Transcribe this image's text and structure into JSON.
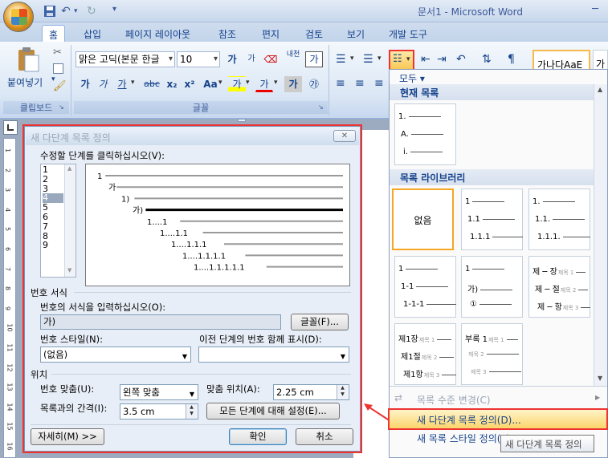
{
  "window": {
    "title": "문서1 - Microsoft Word"
  },
  "tabs": [
    {
      "label": "홈"
    },
    {
      "label": "삽입"
    },
    {
      "label": "페이지 레이아웃"
    },
    {
      "label": "참조"
    },
    {
      "label": "편지"
    },
    {
      "label": "검토"
    },
    {
      "label": "보기"
    },
    {
      "label": "개발 도구"
    }
  ],
  "ribbon": {
    "clipboard": {
      "paste": "붙여넣기",
      "label": "클립보드"
    },
    "font": {
      "name": "맑은 고딕(본문 한글",
      "size": "10",
      "label": "글꼴",
      "grow": "가",
      "shrink": "가",
      "bold": "가",
      "italic": "가",
      "underline": "가",
      "strike": "abc",
      "sub": "x₂",
      "sup": "x²",
      "case": "Aa",
      "highlight": "가",
      "color": "가",
      "charshade": "가",
      "enclose": "㉮",
      "phonetic": "내천",
      "border": "가"
    },
    "styles": {
      "sample1": "가나다AaE",
      "sample2": "가"
    }
  },
  "dialog": {
    "title": "새 다단계 목록 정의",
    "close": "✕",
    "level_prompt": "수정할 단계를 클릭하십시오(V):",
    "levels": [
      "1",
      "2",
      "3",
      "4",
      "5",
      "6",
      "7",
      "8",
      "9"
    ],
    "selected_level": "4",
    "preview_lines": [
      "1",
      "가",
      "1)",
      "가)",
      "1....1",
      "1....1.1",
      "1....1.1.1",
      "1....1.1.1.1",
      "1....1.1.1.1.1"
    ],
    "number_format_section": "번호 서식",
    "format_prompt": "번호의 서식을 입력하십시오(O):",
    "format_value": "가)",
    "font_button": "글꼴(F)...",
    "style_label": "번호 스타일(N):",
    "style_value": "(없음)",
    "prev_level_label": "이전 단계의 번호 함께 표시(D):",
    "prev_level_value": "",
    "position_section": "위치",
    "align_label": "번호 맞춤(U):",
    "align_value": "왼쪽 맞춤",
    "align_at_label": "맞춤 위치(A):",
    "align_at_value": "2.25 cm",
    "indent_label": "목록과의 간격(I):",
    "indent_value": "3.5 cm",
    "set_all_button": "모든 단계에 대해 설정(E)...",
    "more_button": "자세히(M) >>",
    "ok": "확인",
    "cancel": "취소"
  },
  "gallery": {
    "filter": "모두 ▾",
    "current_header": "현재 목록",
    "current_lines": [
      "1.",
      "A.",
      "i."
    ],
    "library_header": "목록 라이브러리",
    "none_label": "없음",
    "thumbs": [
      [
        "1",
        "1.1",
        "1.1.1"
      ],
      [
        "1.",
        "1.1.",
        "1.1.1."
      ],
      [
        "1",
        "1-1",
        "1-1-1"
      ],
      [
        "1",
        "가)",
        "①"
      ],
      [
        "제 ─ 장",
        "제 ─ 절",
        "제 ─ 항"
      ],
      [
        "제1장",
        "제1절",
        "제1항"
      ],
      [
        "부록 1",
        "",
        ""
      ]
    ],
    "thumb_suffix": [
      "제목 1",
      "제목 2",
      "제목 3"
    ],
    "change_level": "목록 수준 변경(C)",
    "define_new_list": "새 다단계 목록 정의(D)...",
    "define_new_style": "새 목록 스타일 정의(L)...",
    "tooltip": "새 다단계 목록 정의"
  },
  "ruler_numbers": [
    "1",
    "2",
    "3",
    "4",
    "5",
    "6",
    "7",
    "8",
    "9",
    "10",
    "11",
    "12",
    "13",
    "14",
    "15",
    "16"
  ],
  "colors": {
    "accent": "#15428b",
    "highlight": "#ee3333",
    "selected": "#fbd56c"
  }
}
